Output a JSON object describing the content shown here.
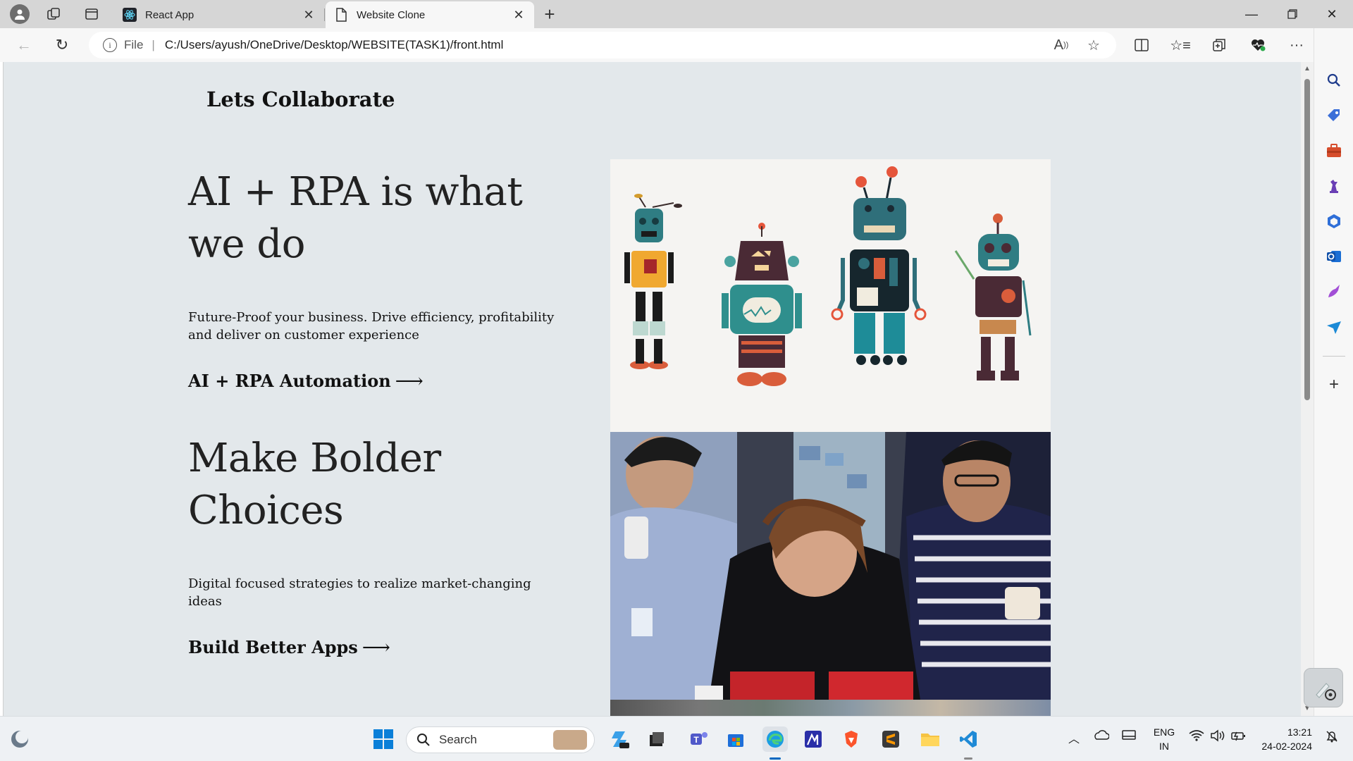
{
  "browser": {
    "tabs": [
      {
        "title": "React App",
        "active": false
      },
      {
        "title": "Website Clone",
        "active": true
      }
    ],
    "address": {
      "scheme_label": "File",
      "url": "C:/Users/ayush/OneDrive/Desktop/WEBSITE(TASK1)/front.html"
    }
  },
  "page": {
    "site_title": "Lets Collaborate",
    "sections": [
      {
        "headline": "AI + RPA is what we do",
        "subtext": "Future-Proof your business. Drive efficiency, profitability and deliver on customer experience",
        "cta": "AI + RPA Automation",
        "arrow": "⟶"
      },
      {
        "headline": "Make Bolder Choices",
        "subtext": "Digital focused strategies to realize market-changing ideas",
        "cta": "Build Better Apps",
        "arrow": "⟶"
      }
    ]
  },
  "taskbar": {
    "search_label": "Search",
    "language": {
      "line1": "ENG",
      "line2": "IN"
    },
    "time": "13:21",
    "date": "24-02-2024"
  },
  "colors": {
    "page_bg": "#e3e8eb",
    "tab_strip": "#d6d6d6",
    "toolbar": "#f7f7f7",
    "windows_blue": "#0067c0"
  }
}
